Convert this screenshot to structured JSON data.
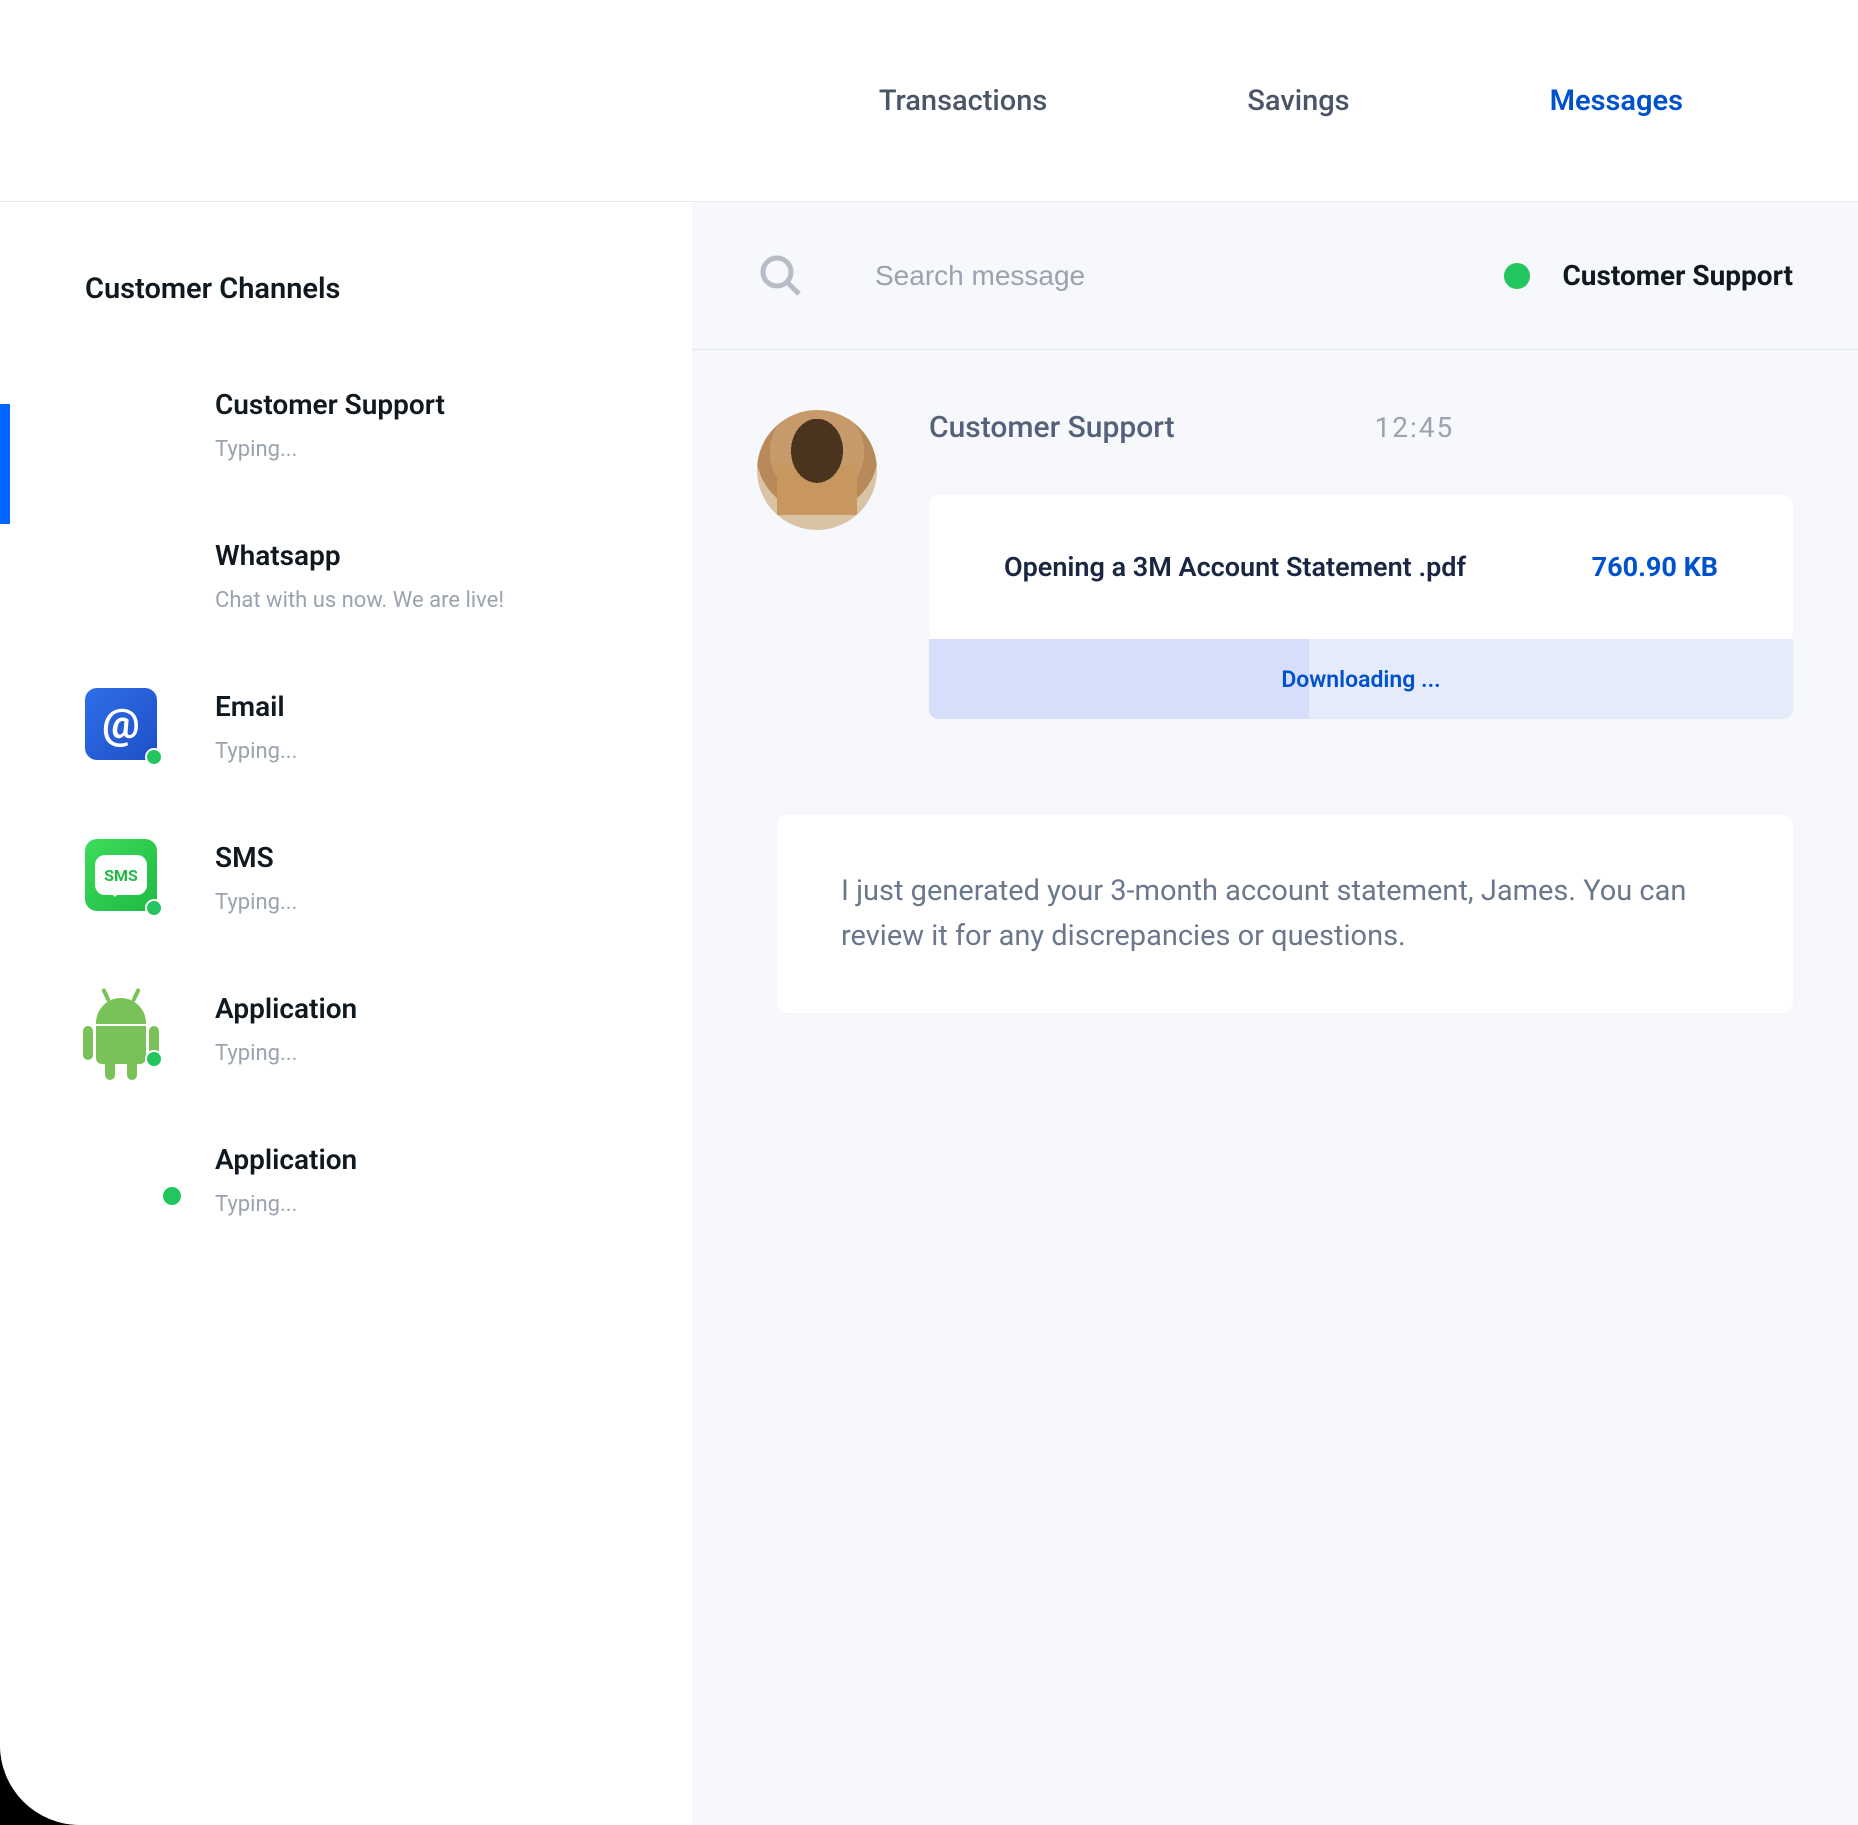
{
  "nav": {
    "transactions": "Transactions",
    "savings": "Savings",
    "messages": "Messages"
  },
  "sidebar": {
    "title": "Customer Channels",
    "items": [
      {
        "name": "Customer Support",
        "sub": "Typing..."
      },
      {
        "name": "Whatsapp",
        "sub": "Chat with us now. We are live!"
      },
      {
        "name": "Email",
        "sub": "Typing..."
      },
      {
        "name": "SMS",
        "sub": "Typing..."
      },
      {
        "name": "Application",
        "sub": "Typing..."
      },
      {
        "name": "Application",
        "sub": "Typing..."
      }
    ]
  },
  "search": {
    "placeholder": "Search message"
  },
  "header": {
    "support_label": "Customer Support"
  },
  "message": {
    "sender": "Customer Support",
    "time": "12:45",
    "file": {
      "name": "Opening a 3M Account Statement .pdf",
      "size": "760.90 KB",
      "status": "Downloading ..."
    },
    "text": "I just generated your 3-month account statement, James. You can review it for any discrepancies or questions."
  }
}
